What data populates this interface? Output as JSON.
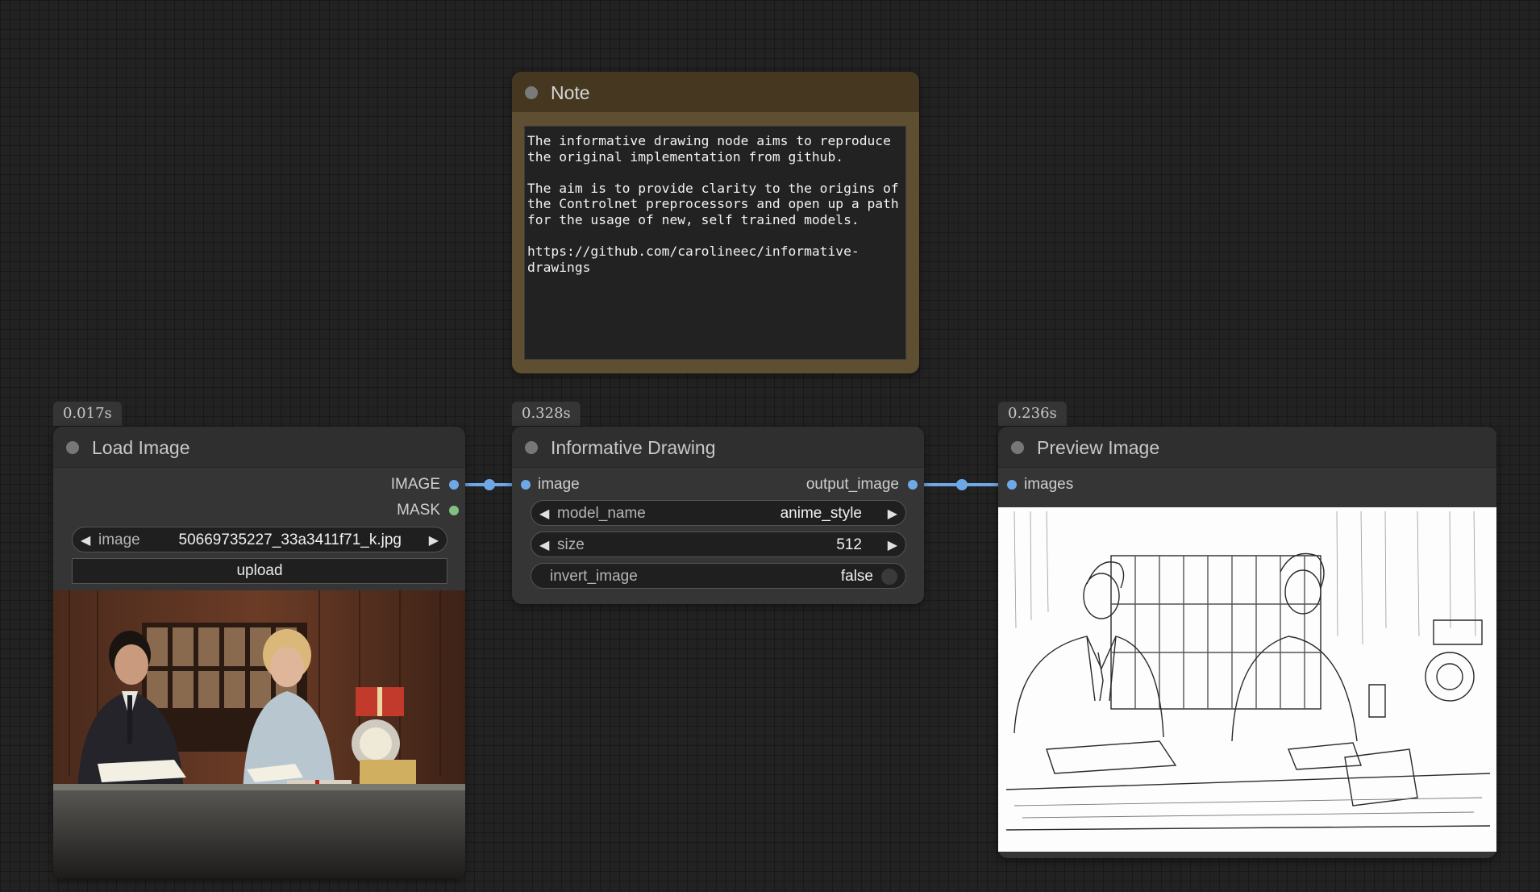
{
  "timings": {
    "load_image": "0.017s",
    "informative_drawing": "0.328s",
    "preview_image": "0.236s"
  },
  "note": {
    "title": "Note",
    "text": "The informative drawing node aims to reproduce\nthe original implementation from github.\n\nThe aim is to provide clarity to the origins of\nthe Controlnet preprocessors and open up a path\nfor the usage of new, self trained models.\n\nhttps://github.com/carolineec/informative-\ndrawings"
  },
  "load_image": {
    "title": "Load Image",
    "outputs": {
      "image": "IMAGE",
      "mask": "MASK"
    },
    "image_widget": {
      "label": "image",
      "value": "50669735227_33a3411f71_k.jpg"
    },
    "upload_label": "upload"
  },
  "informative_drawing": {
    "title": "Informative Drawing",
    "input": "image",
    "output": "output_image",
    "model_name": {
      "label": "model_name",
      "value": "anime_style"
    },
    "size": {
      "label": "size",
      "value": "512"
    },
    "invert_image": {
      "label": "invert_image",
      "value": "false"
    }
  },
  "preview_image": {
    "title": "Preview Image",
    "input": "images"
  },
  "colors": {
    "link_image": "#6fa8e6",
    "mask_port": "#82c082",
    "note_bg": "#5e4e32"
  }
}
